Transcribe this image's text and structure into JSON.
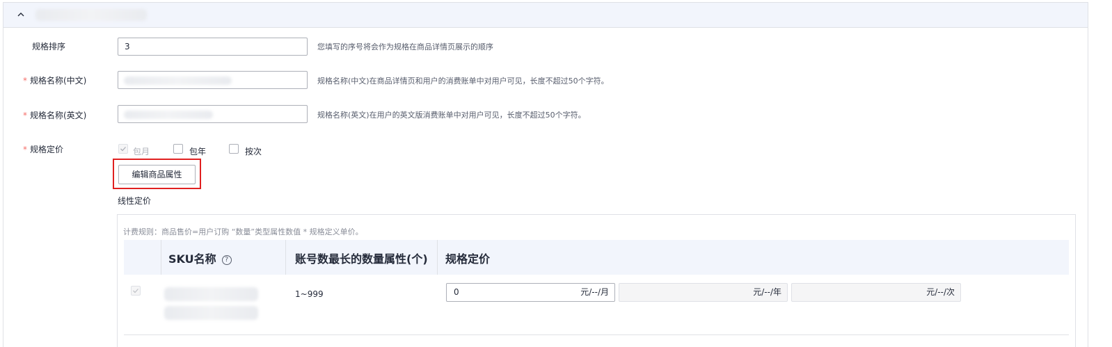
{
  "fields": {
    "sort": {
      "label": "规格排序",
      "value": "3",
      "hint": "您填写的序号将会作为规格在商品详情页展示的顺序"
    },
    "name_cn": {
      "label": "规格名称(中文)",
      "hint": "规格名称(中文)在商品详情页和用户的消费账单中对用户可见，长度不超过50个字符。"
    },
    "name_en": {
      "label": "规格名称(英文)",
      "hint": "规格名称(英文)在用户的英文版消费账单中对用户可见，长度不超过50个字符。"
    },
    "pricing": {
      "label": "规格定价",
      "options": [
        {
          "label": "包月",
          "checked": true,
          "disabled": true
        },
        {
          "label": "包年",
          "checked": false,
          "disabled": false
        },
        {
          "label": "按次",
          "checked": false,
          "disabled": false
        }
      ]
    }
  },
  "required_mark": "*",
  "edit_button": "编辑商品属性",
  "linear_label": "线性定价",
  "billing_rule": "计费规则：商品售价=用户订购 “数量”类型属性数值 * 规格定义单价。",
  "table": {
    "headers": {
      "sku": "SKU名称",
      "qty": "账号数最长的数量属性(个)",
      "price": "规格定价"
    },
    "help_icon": "?",
    "row": {
      "range": "1~999",
      "monthly_value": "0",
      "monthly_unit": "元/--/月",
      "yearly_unit": "元/--/年",
      "per_use_unit": "元/--/次"
    }
  }
}
